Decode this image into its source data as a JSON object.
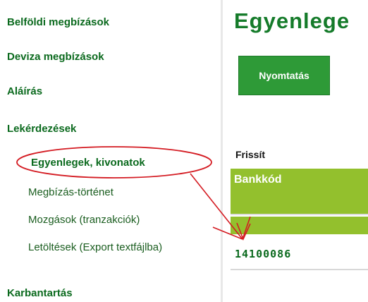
{
  "sidebar": {
    "items": [
      {
        "label": "Belföldi megbízások"
      },
      {
        "label": "Deviza megbízások"
      },
      {
        "label": "Aláírás"
      },
      {
        "label": "Lekérdezések"
      },
      {
        "label": "Karbantartás"
      }
    ],
    "subitems": [
      {
        "label": "Egyenlegek, kivonatok",
        "active": true
      },
      {
        "label": "Megbízás-történet"
      },
      {
        "label": "Mozgások (tranzakciók)"
      },
      {
        "label": "Letöltések (Export textfájlba)"
      }
    ]
  },
  "main": {
    "title": "Egyenlege",
    "print_button": "Nyomtatás",
    "refresh_label": "Frissít",
    "table": {
      "header": "Bankkód",
      "rows": [
        {
          "bank_code": "14100086"
        }
      ]
    }
  },
  "colors": {
    "nav_green": "#0b6a1e",
    "button_green": "#2e9a37",
    "table_header_green": "#93c02d",
    "annotation_red": "#d41b22"
  }
}
